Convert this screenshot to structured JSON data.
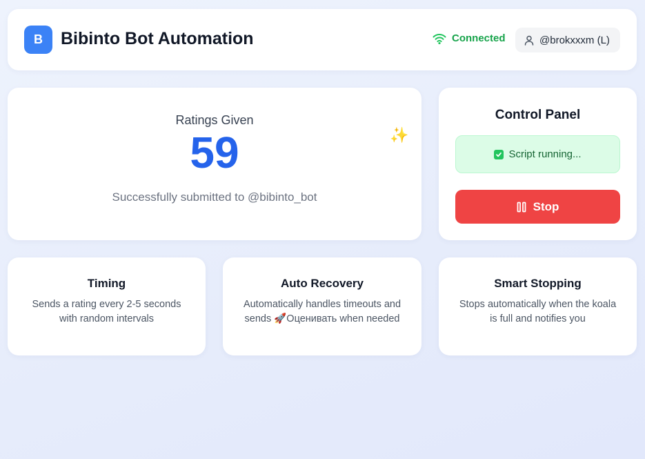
{
  "header": {
    "logo_letter": "B",
    "title": "Bibinto Bot Automation",
    "connection_status": "Connected",
    "user": "@brokxxxm (L)"
  },
  "ratings": {
    "label": "Ratings Given",
    "count": "59",
    "subtitle": "Successfully submitted to @bibinto_bot",
    "sparkle": "✨"
  },
  "control_panel": {
    "title": "Control Panel",
    "status": "Script running...",
    "stop_label": "Stop"
  },
  "features": [
    {
      "title": "Timing",
      "description": "Sends a rating every 2-5 seconds with random intervals"
    },
    {
      "title": "Auto Recovery",
      "description": "Automatically handles timeouts and sends 🚀Оценивать when needed"
    },
    {
      "title": "Smart Stopping",
      "description": "Stops automatically when the koala is full and notifies you"
    }
  ],
  "colors": {
    "accent": "#3b82f6",
    "count": "#2563eb",
    "success": "#16a34a",
    "danger": "#ef4444"
  },
  "icons": {
    "logo": "logo-badge",
    "connection": "wifi-icon",
    "user": "user-icon",
    "sparkle": "sparkles-icon",
    "status": "check-square-icon",
    "stop": "pause-icon"
  }
}
